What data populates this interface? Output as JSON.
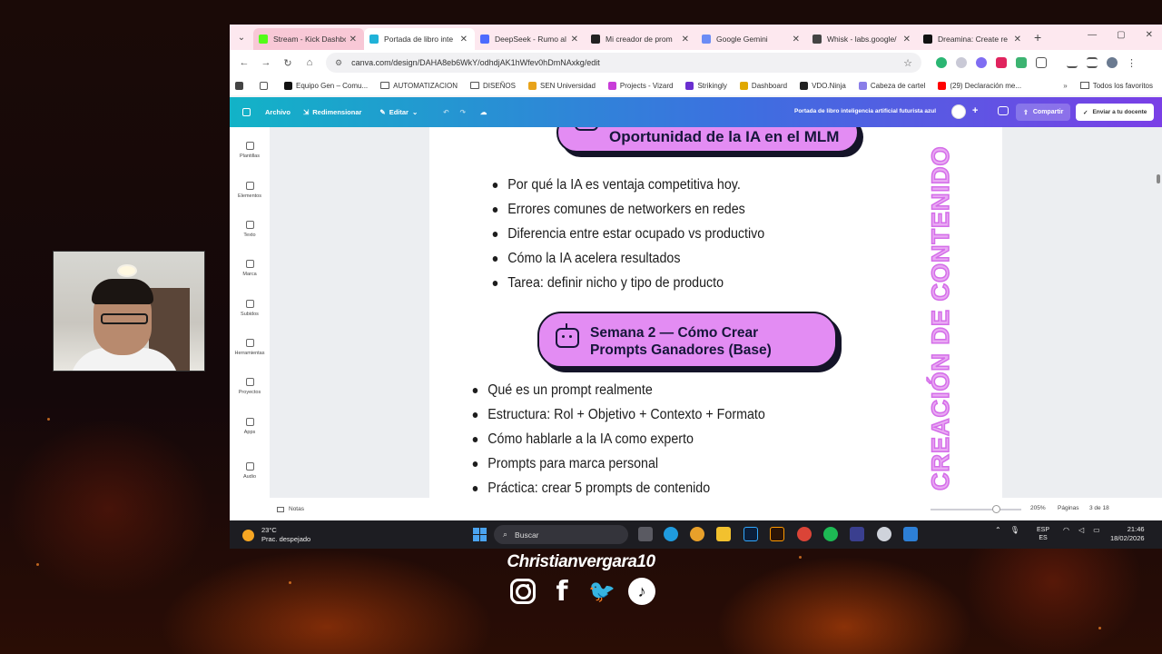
{
  "browser": {
    "tabs": [
      {
        "label": "Stream - Kick Dashbo",
        "favicon_color": "#53fc18",
        "state": "hover"
      },
      {
        "label": "Portada de libro inte",
        "favicon_color": "#20b2d8",
        "state": "active"
      },
      {
        "label": "DeepSeek - Rumo al",
        "favicon_color": "#4d6bfe",
        "state": "normal"
      },
      {
        "label": "Mi creador de prom",
        "favicon_color": "#222222",
        "state": "normal"
      },
      {
        "label": "Google Gemini",
        "favicon_color": "#6b8cf5",
        "state": "normal"
      },
      {
        "label": "Whisk - labs.google/",
        "favicon_color": "#444444",
        "state": "normal"
      },
      {
        "label": "Dreamina: Create re",
        "favicon_color": "#111111",
        "state": "normal"
      }
    ],
    "url": "canva.com/design/DAHA8eb6WkY/odhdjAK1hWfev0hDmNAxkg/edit",
    "bookmarks": [
      {
        "label": "Equipo Gen – Comu...",
        "type": "site",
        "color": "#111111"
      },
      {
        "label": "AUTOMATIZACION",
        "type": "folder"
      },
      {
        "label": "DISEÑOS",
        "type": "folder"
      },
      {
        "label": "SEN Universidad",
        "type": "site",
        "color": "#e8a31a"
      },
      {
        "label": "Projects - Vizard",
        "type": "site",
        "color": "#c83dd8"
      },
      {
        "label": "Strikingly",
        "type": "site",
        "color": "#6a2fd0"
      },
      {
        "label": "Dashboard",
        "type": "site",
        "color": "#e0a800"
      },
      {
        "label": "VDO.Ninja",
        "type": "site",
        "color": "#222222"
      },
      {
        "label": "Cabeza de cartel",
        "type": "site",
        "color": "#8a7ee8"
      },
      {
        "label": "(29) Declaración me...",
        "type": "site",
        "color": "#ff0000"
      }
    ],
    "all_bookmarks": "Todos los favoritos"
  },
  "canva": {
    "menu": {
      "file": "Archivo",
      "resize": "Redimensionar",
      "edit": "Editar"
    },
    "doc_title": "Portada de libro inteligencia artificial futurista azul",
    "share": "Compartir",
    "send": "Enviar a tu docente",
    "sidebar": [
      "Plantillas",
      "Elementos",
      "Texto",
      "Marca",
      "Subidos",
      "Herramientas",
      "Proyectos",
      "Apps",
      "Audio"
    ],
    "notes": "Notas",
    "zoom": "205%",
    "pages_label": "Páginas",
    "pages_count": "3 de 18"
  },
  "design": {
    "heading1": "Oportunidad de la IA en el MLM",
    "list1": [
      "Por qué la IA es ventaja competitiva hoy.",
      "Errores comunes de networkers en redes",
      "Diferencia entre estar ocupado vs productivo",
      "Cómo la IA acelera resultados",
      "Tarea: definir nicho y tipo de producto"
    ],
    "heading2_line1": "Semana 2 — Cómo Crear",
    "heading2_line2": "Prompts Ganadores (Base)",
    "list2": [
      "Qué es un prompt realmente",
      "Estructura: Rol + Objetivo + Contexto + Formato",
      "Cómo hablarle a la IA como experto",
      "Prompts para marca personal",
      "Práctica: crear 5 prompts de contenido"
    ],
    "vertical_text": "CREACIÓN DE CONTENIDO",
    "accent_color": "#e38cf3"
  },
  "taskbar": {
    "temp": "23°C",
    "weather": "Prac. despejado",
    "search": "Buscar",
    "lang1": "ESP",
    "lang2": "ES",
    "time": "21:46",
    "date": "18/02/2026"
  },
  "overlay": {
    "handle": "Christianvergara10"
  }
}
